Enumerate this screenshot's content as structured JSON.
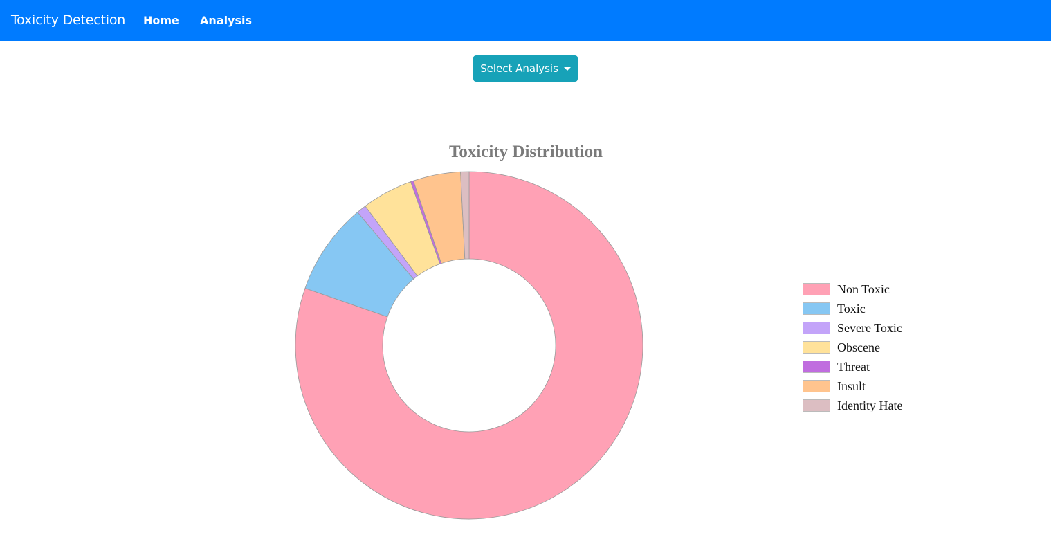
{
  "navbar": {
    "brand": "Toxicity Detection",
    "links": [
      "Home",
      "Analysis"
    ],
    "color": "#007bff"
  },
  "dropdown": {
    "label": "Select Analysis",
    "color": "#17a2b8"
  },
  "chart_data": {
    "type": "pie",
    "variant": "doughnut",
    "title": "Toxicity Distribution",
    "legend_position": "right",
    "labels": [
      "Non Toxic",
      "Toxic",
      "Severe Toxic",
      "Obscene",
      "Threat",
      "Insult",
      "Identity Hate"
    ],
    "values": [
      143346,
      15294,
      1595,
      8449,
      478,
      7877,
      1405
    ],
    "colors": [
      "#ffa1b5",
      "#86c7f3",
      "#c3a4f9",
      "#ffe29a",
      "#c06ddf",
      "#ffc48e",
      "#dcbec2"
    ]
  }
}
